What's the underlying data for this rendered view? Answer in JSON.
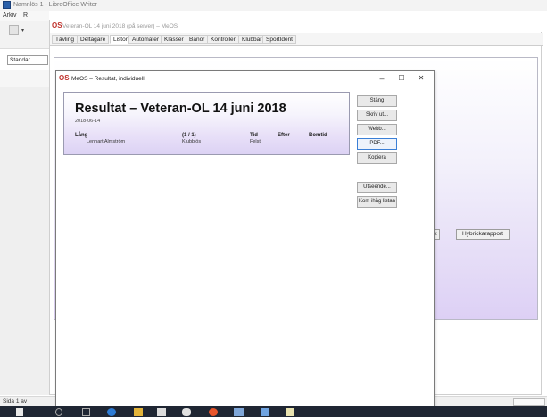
{
  "libreoffice": {
    "title": "Namnlös 1 - LibreOffice Writer",
    "menu": [
      "Arkiv",
      "R"
    ],
    "style_box": "Standar",
    "status": "Sida 1 av"
  },
  "meos_main": {
    "title": "Veteran-OL 14 juni 2018 (på server) – MeOS",
    "tabs": [
      "Tävling",
      "Deltagare",
      "Listor",
      "Automater",
      "Klasser",
      "Banor",
      "Kontroller",
      "Klubbar",
      "SportIdent"
    ],
    "active_tab": "Listor",
    "partial_button": "k",
    "hyb_button": "Hybrickarapport"
  },
  "dialog": {
    "title": "MeOS – Resultat, individuell",
    "controls": {
      "minimize": "–",
      "maximize": "☐",
      "close": "✕"
    },
    "buttons": [
      "Stäng",
      "Skriv ut...",
      "Webb...",
      "PDF...",
      "Kopiera",
      "Utseende...",
      "Kom ihåg listan"
    ],
    "focused_button": "PDF..."
  },
  "report": {
    "title": "Resultat – Veteran-OL 14 juni 2018",
    "date": "2018-06-14",
    "class_name": "Lång",
    "count": "(1 / 1)",
    "headers": {
      "time": "Tid",
      "after": "Efter",
      "missed": "Bomtid"
    },
    "rows": [
      {
        "name": "Lennart Almström",
        "club": "Klubblös",
        "time": "Felst."
      }
    ]
  },
  "colors": {
    "report_gradient_end": "#dcd2f4",
    "panel_gradient_end": "#ddd0f5",
    "meos_logo": "#c0312b",
    "taskbar": "#1f2633",
    "focus": "#3b7fd6"
  }
}
